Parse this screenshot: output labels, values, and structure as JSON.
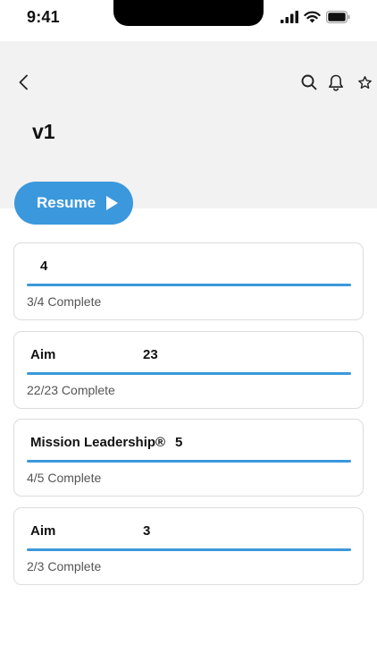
{
  "status_bar": {
    "time": "9:41",
    "icons": [
      "cellular-signal-icon",
      "wifi-icon",
      "battery-icon"
    ]
  },
  "header": {
    "title": "v1",
    "back_icon": "chevron-left-icon",
    "actions": [
      "search-icon",
      "bell-icon",
      "star-icon"
    ]
  },
  "resume_button": {
    "label": "Resume",
    "icon": "play-icon"
  },
  "accent_color": "#3b98dc",
  "courses": [
    {
      "name": "",
      "count": "4",
      "status": "3/4 Complete",
      "progress": 1.0
    },
    {
      "name": "Aim",
      "count": "23",
      "status": "22/23 Complete",
      "progress": 1.0
    },
    {
      "name": "Mission Leadership®",
      "count": "5",
      "status": "4/5 Complete",
      "progress": 1.0
    },
    {
      "name": "Aim",
      "count": "3",
      "status": "2/3 Complete",
      "progress": 1.0
    }
  ]
}
